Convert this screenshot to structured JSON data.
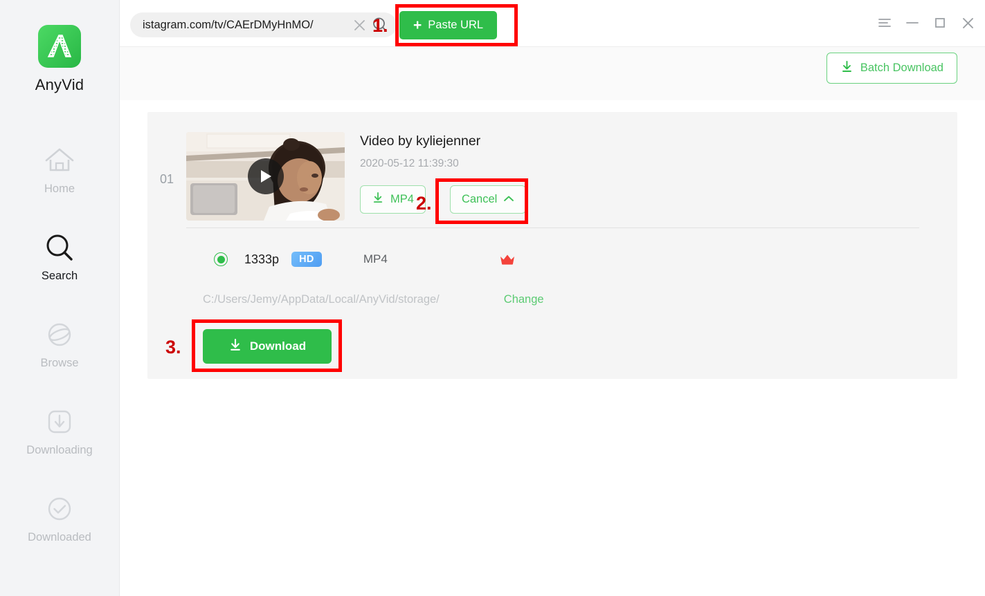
{
  "app": {
    "brand_name": "AnyVid",
    "logo_icon": "anyvid-logo-icon"
  },
  "sidebar": {
    "items": [
      {
        "label": "Home",
        "icon": "home-icon",
        "active": false
      },
      {
        "label": "Search",
        "icon": "search-icon",
        "active": true
      },
      {
        "label": "Browse",
        "icon": "browse-globe-icon",
        "active": false
      },
      {
        "label": "Downloading",
        "icon": "downloading-icon",
        "active": false
      },
      {
        "label": "Downloaded",
        "icon": "downloaded-check-icon",
        "active": false
      }
    ]
  },
  "topbar": {
    "url_value": "istagram.com/tv/CAErDMyHnMO/",
    "url_placeholder": "Paste or enter the video URL here",
    "clear_icon": "close-icon",
    "search_icon": "search-icon",
    "paste_button": "Paste URL",
    "plus_glyph": "+",
    "window_controls": [
      {
        "name": "menu-icon"
      },
      {
        "name": "minimize-icon"
      },
      {
        "name": "maximize-icon"
      },
      {
        "name": "close-icon"
      }
    ]
  },
  "batchbar": {
    "batch_download_label": "Batch Download",
    "batch_download_icon": "download-icon"
  },
  "result": {
    "index": "01",
    "title": "Video by kyliejenner",
    "date": "2020-05-12 11:39:30",
    "play_icon": "play-icon",
    "format_button": "MP4",
    "format_button_icon": "download-icon",
    "cancel_button": "Cancel",
    "cancel_chevron_icon": "chevron-up-icon",
    "quality": {
      "selected": true,
      "resolution": "1333p",
      "hd_badge": "HD",
      "format": "MP4",
      "premium_icon": "crown-icon"
    },
    "save_path": "C:/Users/Jemy/AppData/Local/AnyVid/storage/",
    "change_link": "Change",
    "download_button": "Download",
    "download_button_icon": "download-icon"
  },
  "annotations": {
    "step1": "1.",
    "step2": "2.",
    "step3": "3."
  },
  "colors": {
    "brand_green": "#2fbd4a",
    "light_green": "#5ccb73",
    "hd_blue": "#4f9df2",
    "crown_red": "#f4433b",
    "annotation_red": "#ff0000",
    "sidebar_bg": "#f3f4f6",
    "card_bg": "#f5f5f5"
  }
}
